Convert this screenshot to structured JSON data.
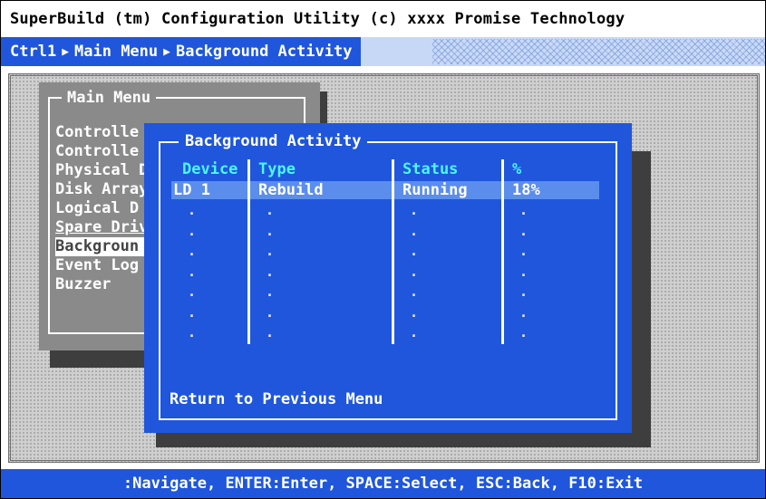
{
  "title": "SuperBuild (tm) Configuration Utility (c) xxxx Promise Technology",
  "breadcrumb": [
    "Ctrl1",
    "Main Menu",
    "Background Activity"
  ],
  "main_menu": {
    "title": "Main Menu",
    "items": [
      {
        "label": "Controlle"
      },
      {
        "label": "Controlle"
      },
      {
        "label": "Physical D"
      },
      {
        "label": "Disk Array"
      },
      {
        "label": "Logical D"
      },
      {
        "label": "Spare Driv"
      },
      {
        "label": "Backgroun"
      },
      {
        "label": "Event Log"
      },
      {
        "label": "Buzzer"
      }
    ]
  },
  "background_activity": {
    "title": "Background Activity",
    "columns": [
      "Device",
      "Type",
      "Status",
      "%"
    ],
    "rows": [
      {
        "device": "LD 1",
        "type": "Rebuild",
        "status": "Running",
        "percent": "18%"
      }
    ],
    "empty_marker": ".",
    "return_label": "Return to Previous Menu"
  },
  "status_bar": ":Navigate, ENTER:Enter, SPACE:Select, ESC:Back, F10:Exit",
  "colors": {
    "blue": "#1f56db",
    "header_cyan": "#4bf6ff",
    "selection": "#5b8ded",
    "menu_gray": "#8a8a8a"
  }
}
